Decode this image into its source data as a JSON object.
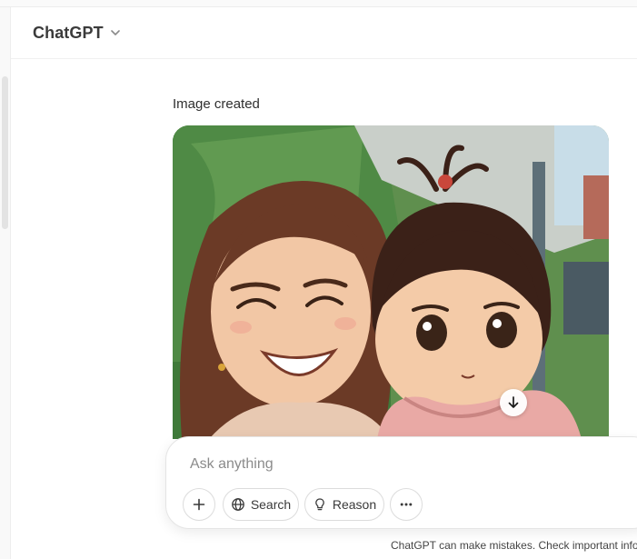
{
  "header": {
    "model_name": "ChatGPT",
    "model_dropdown_icon": "chevron-down-icon"
  },
  "message": {
    "status_label": "Image created",
    "image_alt": "Anime-style illustration of a smiling woman and a young child in a pink hoodie",
    "download_icon": "arrow-down-icon"
  },
  "composer": {
    "placeholder": "Ask anything",
    "value": "",
    "add_icon": "plus-icon",
    "search_label": "Search",
    "search_icon": "globe-icon",
    "reason_label": "Reason",
    "reason_icon": "lightbulb-icon",
    "more_icon": "ellipsis-icon"
  },
  "footer": {
    "disclaimer": "ChatGPT can make mistakes. Check important info."
  },
  "colors": {
    "background": "#ffffff",
    "sidebar": "#f9f9f9",
    "text_primary": "#0d0d0d",
    "placeholder": "#8b8b8b",
    "border": "#e5e5e5"
  }
}
